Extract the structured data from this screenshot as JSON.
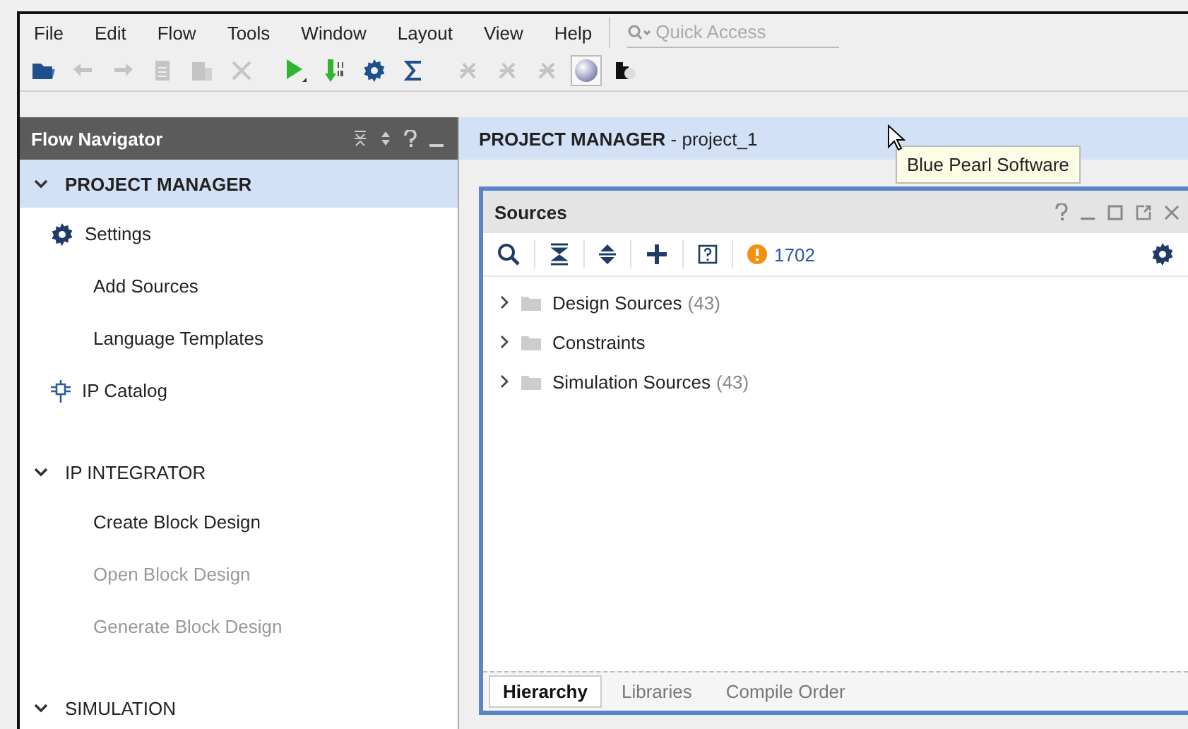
{
  "menu": [
    {
      "label": "File"
    },
    {
      "label": "Edit"
    },
    {
      "label": "Flow"
    },
    {
      "label": "Tools"
    },
    {
      "label": "Window"
    },
    {
      "label": "Layout"
    },
    {
      "label": "View"
    },
    {
      "label": "Help"
    }
  ],
  "quick_access": {
    "placeholder": "Quick Access"
  },
  "toolbar": [
    {
      "kind": "open",
      "disabled": false
    },
    {
      "kind": "undo",
      "disabled": true
    },
    {
      "kind": "redo",
      "disabled": true
    },
    {
      "kind": "copy",
      "disabled": true
    },
    {
      "kind": "paste",
      "disabled": true
    },
    {
      "kind": "delete",
      "disabled": true
    },
    {
      "kind": "run",
      "disabled": false
    },
    {
      "kind": "bitstream",
      "disabled": false
    },
    {
      "kind": "settings",
      "disabled": false
    },
    {
      "kind": "sigma",
      "disabled": false
    },
    {
      "kind": "tool",
      "disabled": true
    },
    {
      "kind": "tool",
      "disabled": true
    },
    {
      "kind": "tool",
      "disabled": true
    },
    {
      "kind": "pearl",
      "disabled": false,
      "highlighted": true
    },
    {
      "kind": "plugin",
      "disabled": false,
      "highlighted": false
    }
  ],
  "tooltip": "Blue Pearl Software",
  "flow_navigator": {
    "title": "Flow Navigator",
    "sections": [
      {
        "label": "PROJECT MANAGER",
        "expanded": true,
        "selected": true,
        "children": [
          {
            "label": "Settings",
            "kind": "gear",
            "disabled": false
          },
          {
            "label": "Add Sources",
            "kind": "plain",
            "disabled": false
          },
          {
            "label": "Language Templates",
            "kind": "plain",
            "disabled": false
          },
          {
            "label": "IP Catalog",
            "kind": "chip",
            "disabled": false
          }
        ]
      },
      {
        "label": "IP INTEGRATOR",
        "expanded": true,
        "selected": false,
        "children": [
          {
            "label": "Create Block Design",
            "kind": "plain",
            "disabled": false
          },
          {
            "label": "Open Block Design",
            "kind": "plain",
            "disabled": true
          },
          {
            "label": "Generate Block Design",
            "kind": "plain",
            "disabled": true
          }
        ]
      },
      {
        "label": "SIMULATION",
        "expanded": true,
        "selected": false
      }
    ]
  },
  "main_header": {
    "title": "PROJECT MANAGER",
    "subtitle": "- project_1"
  },
  "sources": {
    "title": "Sources",
    "warning_count": "1702",
    "tree": [
      {
        "label": "Design Sources",
        "count": "(43)",
        "expanded": false
      },
      {
        "label": "Constraints",
        "expanded": false
      },
      {
        "label": "Simulation Sources",
        "count": "(43)",
        "expanded": false
      }
    ],
    "tabs": [
      {
        "label": "Hierarchy",
        "selected": true
      },
      {
        "label": "Libraries",
        "selected": false
      },
      {
        "label": "Compile Order",
        "selected": false
      }
    ]
  }
}
